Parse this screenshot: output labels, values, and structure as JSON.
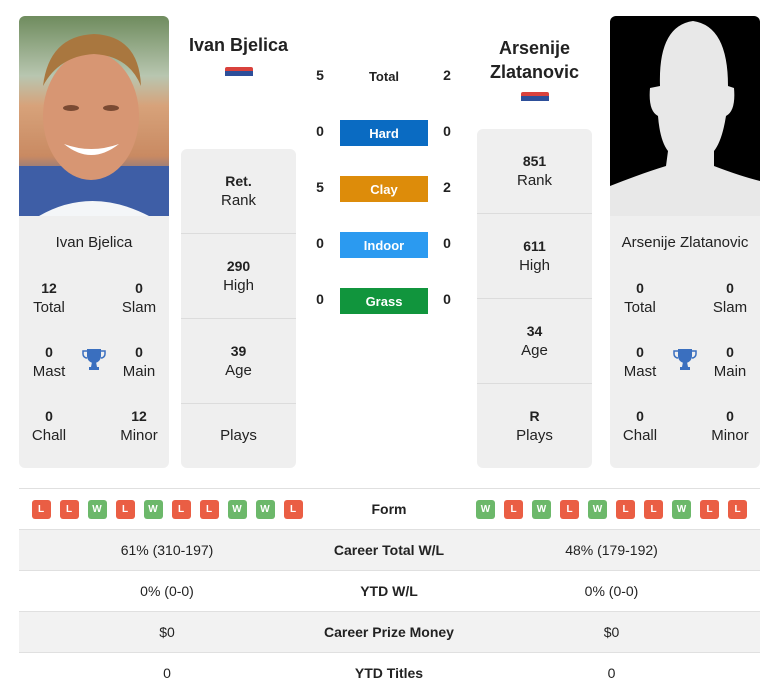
{
  "player1": {
    "name": "Ivan Bjelica",
    "card_name": "Ivan Bjelica",
    "flag": "serbia-flag",
    "titles": {
      "total": {
        "value": "12",
        "label": "Total"
      },
      "slam": {
        "value": "0",
        "label": "Slam"
      },
      "mast": {
        "value": "0",
        "label": "Mast"
      },
      "main": {
        "value": "0",
        "label": "Main"
      },
      "chall": {
        "value": "0",
        "label": "Chall"
      },
      "minor": {
        "value": "12",
        "label": "Minor"
      }
    },
    "rank": {
      "value": "Ret.",
      "label": "Rank"
    },
    "high": {
      "value": "290",
      "label": "High"
    },
    "age": {
      "value": "39",
      "label": "Age"
    },
    "plays": {
      "value": "",
      "label": "Plays"
    },
    "form": [
      "L",
      "L",
      "W",
      "L",
      "W",
      "L",
      "L",
      "W",
      "W",
      "L"
    ],
    "career_wl": "61% (310-197)",
    "ytd_wl": "0% (0-0)",
    "prize": "$0",
    "ytd_titles": "0"
  },
  "player2": {
    "name_line1": "Arsenije",
    "name_line2": "Zlatanovic",
    "card_name": "Arsenije Zlatanovic",
    "flag": "serbia-flag",
    "titles": {
      "total": {
        "value": "0",
        "label": "Total"
      },
      "slam": {
        "value": "0",
        "label": "Slam"
      },
      "mast": {
        "value": "0",
        "label": "Mast"
      },
      "main": {
        "value": "0",
        "label": "Main"
      },
      "chall": {
        "value": "0",
        "label": "Chall"
      },
      "minor": {
        "value": "0",
        "label": "Minor"
      }
    },
    "rank": {
      "value": "851",
      "label": "Rank"
    },
    "high": {
      "value": "611",
      "label": "High"
    },
    "age": {
      "value": "34",
      "label": "Age"
    },
    "plays": {
      "value": "R",
      "label": "Plays"
    },
    "form": [
      "W",
      "L",
      "W",
      "L",
      "W",
      "L",
      "L",
      "W",
      "L",
      "L"
    ],
    "career_wl": "48% (179-192)",
    "ytd_wl": "0% (0-0)",
    "prize": "$0",
    "ytd_titles": "0"
  },
  "h2h": {
    "total": {
      "label": "Total",
      "p1": "5",
      "p2": "2"
    },
    "surfaces": [
      {
        "label": "Hard",
        "p1": "0",
        "p2": "0",
        "color": "#0a6bc2"
      },
      {
        "label": "Clay",
        "p1": "5",
        "p2": "2",
        "color": "#dd8c0a"
      },
      {
        "label": "Indoor",
        "p1": "0",
        "p2": "0",
        "color": "#2b9af0"
      },
      {
        "label": "Grass",
        "p1": "0",
        "p2": "0",
        "color": "#11953d"
      }
    ]
  },
  "table": {
    "form_label": "Form",
    "career_label": "Career Total W/L",
    "ytd_label": "YTD W/L",
    "prize_label": "Career Prize Money",
    "titles_label": "YTD Titles"
  }
}
